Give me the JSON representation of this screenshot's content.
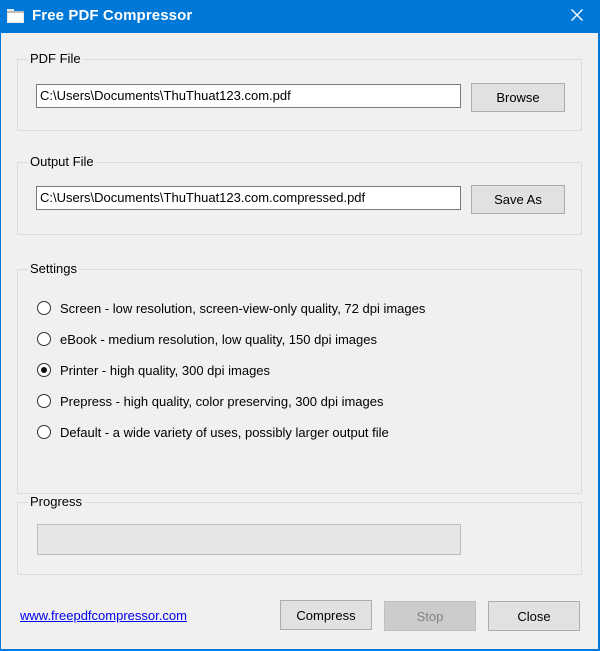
{
  "window": {
    "title": "Free PDF Compressor"
  },
  "pdf_file": {
    "label": "PDF File",
    "value": "C:\\Users\\Documents\\ThuThuat123.com.pdf",
    "browse_label": "Browse"
  },
  "output_file": {
    "label": "Output File",
    "value": "C:\\Users\\Documents\\ThuThuat123.com.compressed.pdf",
    "save_as_label": "Save As"
  },
  "settings": {
    "label": "Settings",
    "selected": "printer",
    "options": [
      {
        "id": "screen",
        "label": "Screen - low resolution, screen-view-only quality, 72 dpi images"
      },
      {
        "id": "ebook",
        "label": "eBook - medium resolution, low quality, 150 dpi images"
      },
      {
        "id": "printer",
        "label": "Printer - high quality, 300 dpi images"
      },
      {
        "id": "prepress",
        "label": "Prepress - high quality, color preserving, 300 dpi images"
      },
      {
        "id": "default",
        "label": "Default - a wide variety of uses, possibly larger output file"
      }
    ]
  },
  "progress": {
    "label": "Progress",
    "value": 0
  },
  "footer": {
    "link_text": "www.freepdfcompressor.com",
    "compress_label": "Compress",
    "stop_label": "Stop",
    "close_label": "Close"
  },
  "colors": {
    "titlebar": "#0078d7",
    "client_bg": "#f0f0f0",
    "link": "#0000ee"
  },
  "icons": {
    "app": "folder-icon",
    "close": "close-icon"
  }
}
